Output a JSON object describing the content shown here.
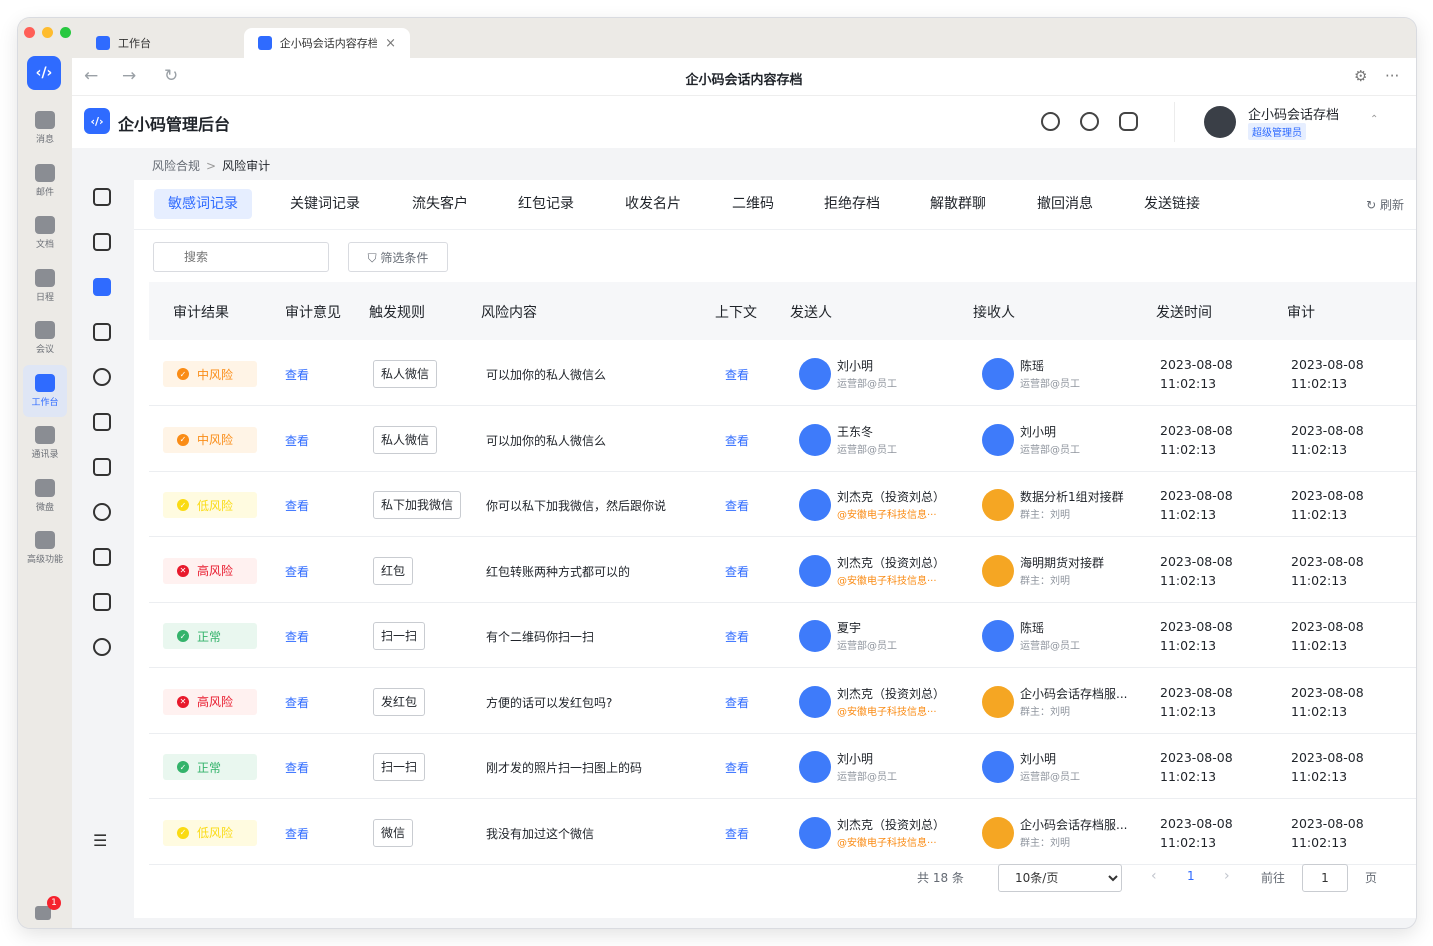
{
  "browser": {
    "tabs": [
      {
        "label": "工作台"
      },
      {
        "label": "企小码会话内容存档"
      }
    ],
    "tab_close": "×",
    "address_title": "企小码会话内容存档",
    "back": "←",
    "forward": "→",
    "reload": "↻",
    "settings": "⚙",
    "more": "···"
  },
  "rail": {
    "logo": "‹/›",
    "items": [
      {
        "label": "消息",
        "icon": "message-icon"
      },
      {
        "label": "邮件",
        "icon": "mail-icon"
      },
      {
        "label": "文档",
        "icon": "doc-icon"
      },
      {
        "label": "日程",
        "icon": "calendar-icon"
      },
      {
        "label": "会议",
        "icon": "meeting-icon"
      },
      {
        "label": "工作台",
        "icon": "workbench-icon",
        "active": true
      },
      {
        "label": "通讯录",
        "icon": "contacts-icon"
      },
      {
        "label": "微盘",
        "icon": "drive-icon"
      },
      {
        "label": "高级功能",
        "icon": "advanced-icon"
      }
    ],
    "notification_count": "1"
  },
  "header": {
    "logo": "‹/›",
    "title": "企小码管理后台",
    "user_name": "企小码会话存档",
    "user_role": "超级管理员",
    "caret": "⌃"
  },
  "breadcrumb": {
    "parent": "风险合规",
    "separator": ">",
    "current": "风险审计"
  },
  "filter_tabs": [
    {
      "label": "敏感词记录",
      "active": true
    },
    {
      "label": "关键词记录"
    },
    {
      "label": "流失客户"
    },
    {
      "label": "红包记录"
    },
    {
      "label": "收发名片"
    },
    {
      "label": "二维码"
    },
    {
      "label": "拒绝存档"
    },
    {
      "label": "解散群聊"
    },
    {
      "label": "撤回消息"
    },
    {
      "label": "发送链接"
    }
  ],
  "refresh_label": "↻ 刷新",
  "search": {
    "placeholder": "搜索"
  },
  "filter_button": "⛉ 筛选条件",
  "columns": {
    "result": "审计结果",
    "opinion": "审计意见",
    "rule": "触发规则",
    "content": "风险内容",
    "context": "上下文",
    "sender": "发送人",
    "receiver": "接收人",
    "send_time": "发送时间",
    "audit": "审计"
  },
  "view_label": "查看",
  "risk_colors": {
    "中风险": {
      "bg": "#fff4e6",
      "fg": "#fa8c16",
      "dot": "#fa8c16",
      "mark": "✓"
    },
    "低风险": {
      "bg": "#fffbe0",
      "fg": "#fadb14",
      "dot": "#fadb14",
      "mark": "✓"
    },
    "高风险": {
      "bg": "#fff1f0",
      "fg": "#e8192c",
      "dot": "#e8192c",
      "mark": "✕"
    },
    "正常": {
      "bg": "#e9f7ef",
      "fg": "#34b36b",
      "dot": "#34b36b",
      "mark": "✓"
    }
  },
  "rows": [
    {
      "risk": "中风险",
      "rule": "私人微信",
      "content": "可以加你的私人微信么",
      "sender": {
        "name": "刘小明",
        "sub": "运营部@员工",
        "type": "employee"
      },
      "receiver": {
        "name": "陈瑶",
        "sub": "运营部@员工",
        "type": "employee"
      },
      "send_date": "2023-08-08",
      "send_clock": "11:02:13",
      "audit_date": "2023-08-08",
      "audit_clock": "11:02:13"
    },
    {
      "risk": "中风险",
      "rule": "私人微信",
      "content": "可以加你的私人微信么",
      "sender": {
        "name": "王东冬",
        "sub": "运营部@员工",
        "type": "employee"
      },
      "receiver": {
        "name": "刘小明",
        "sub": "运营部@员工",
        "type": "employee"
      },
      "send_date": "2023-08-08",
      "send_clock": "11:02:13",
      "audit_date": "2023-08-08",
      "audit_clock": "11:02:13"
    },
    {
      "risk": "低风险",
      "rule": "私下加我微信",
      "content": "你可以私下加我微信，然后跟你说",
      "sender": {
        "name": "刘杰克（投资刘总）",
        "sub": "@安徽电子科技信息···",
        "type": "external"
      },
      "receiver": {
        "name": "数据分析1组对接群",
        "sub": "群主：刘明",
        "type": "group"
      },
      "send_date": "2023-08-08",
      "send_clock": "11:02:13",
      "audit_date": "2023-08-08",
      "audit_clock": "11:02:13"
    },
    {
      "risk": "高风险",
      "rule": "红包",
      "content": "红包转账两种方式都可以的",
      "sender": {
        "name": "刘杰克（投资刘总）",
        "sub": "@安徽电子科技信息···",
        "type": "external"
      },
      "receiver": {
        "name": "海明期货对接群",
        "sub": "群主：刘明",
        "type": "group"
      },
      "send_date": "2023-08-08",
      "send_clock": "11:02:13",
      "audit_date": "2023-08-08",
      "audit_clock": "11:02:13"
    },
    {
      "risk": "正常",
      "rule": "扫一扫",
      "content": "有个二维码你扫一扫",
      "sender": {
        "name": "夏宇",
        "sub": "运营部@员工",
        "type": "employee"
      },
      "receiver": {
        "name": "陈瑶",
        "sub": "运营部@员工",
        "type": "employee"
      },
      "send_date": "2023-08-08",
      "send_clock": "11:02:13",
      "audit_date": "2023-08-08",
      "audit_clock": "11:02:13"
    },
    {
      "risk": "高风险",
      "rule": "发红包",
      "content": "方便的话可以发红包吗?",
      "sender": {
        "name": "刘杰克（投资刘总）",
        "sub": "@安徽电子科技信息···",
        "type": "external"
      },
      "receiver": {
        "name": "企小码会话存档服...",
        "sub": "群主：刘明",
        "type": "group"
      },
      "send_date": "2023-08-08",
      "send_clock": "11:02:13",
      "audit_date": "2023-08-08",
      "audit_clock": "11:02:13"
    },
    {
      "risk": "正常",
      "rule": "扫一扫",
      "content": "刚才发的照片扫一扫图上的码",
      "sender": {
        "name": "刘小明",
        "sub": "运营部@员工",
        "type": "employee"
      },
      "receiver": {
        "name": "刘小明",
        "sub": "运营部@员工",
        "type": "employee"
      },
      "send_date": "2023-08-08",
      "send_clock": "11:02:13",
      "audit_date": "2023-08-08",
      "audit_clock": "11:02:13"
    },
    {
      "risk": "低风险",
      "rule": "微信",
      "content": "我没有加过这个微信",
      "sender": {
        "name": "刘杰克（投资刘总）",
        "sub": "@安徽电子科技信息···",
        "type": "external"
      },
      "receiver": {
        "name": "企小码会话存档服...",
        "sub": "群主：刘明",
        "type": "group"
      },
      "send_date": "2023-08-08",
      "send_clock": "11:02:13",
      "audit_date": "2023-08-08",
      "audit_clock": "11:02:13"
    }
  ],
  "pagination": {
    "total": "共 18 条",
    "page_size": "10条/页",
    "prev": "‹",
    "current_page": "1",
    "next": "›",
    "goto_label": "前往",
    "goto_value": "1",
    "page_unit": "页"
  },
  "colors": {
    "accent": "#2f6bff",
    "employee_avatar": "#3e7bfa",
    "external_avatar": "#3e7bfa",
    "group_avatar": "#f5a623",
    "employee_sub": "#8f959e",
    "external_sub": "#fa8c16",
    "group_sub": "#8f959e"
  }
}
